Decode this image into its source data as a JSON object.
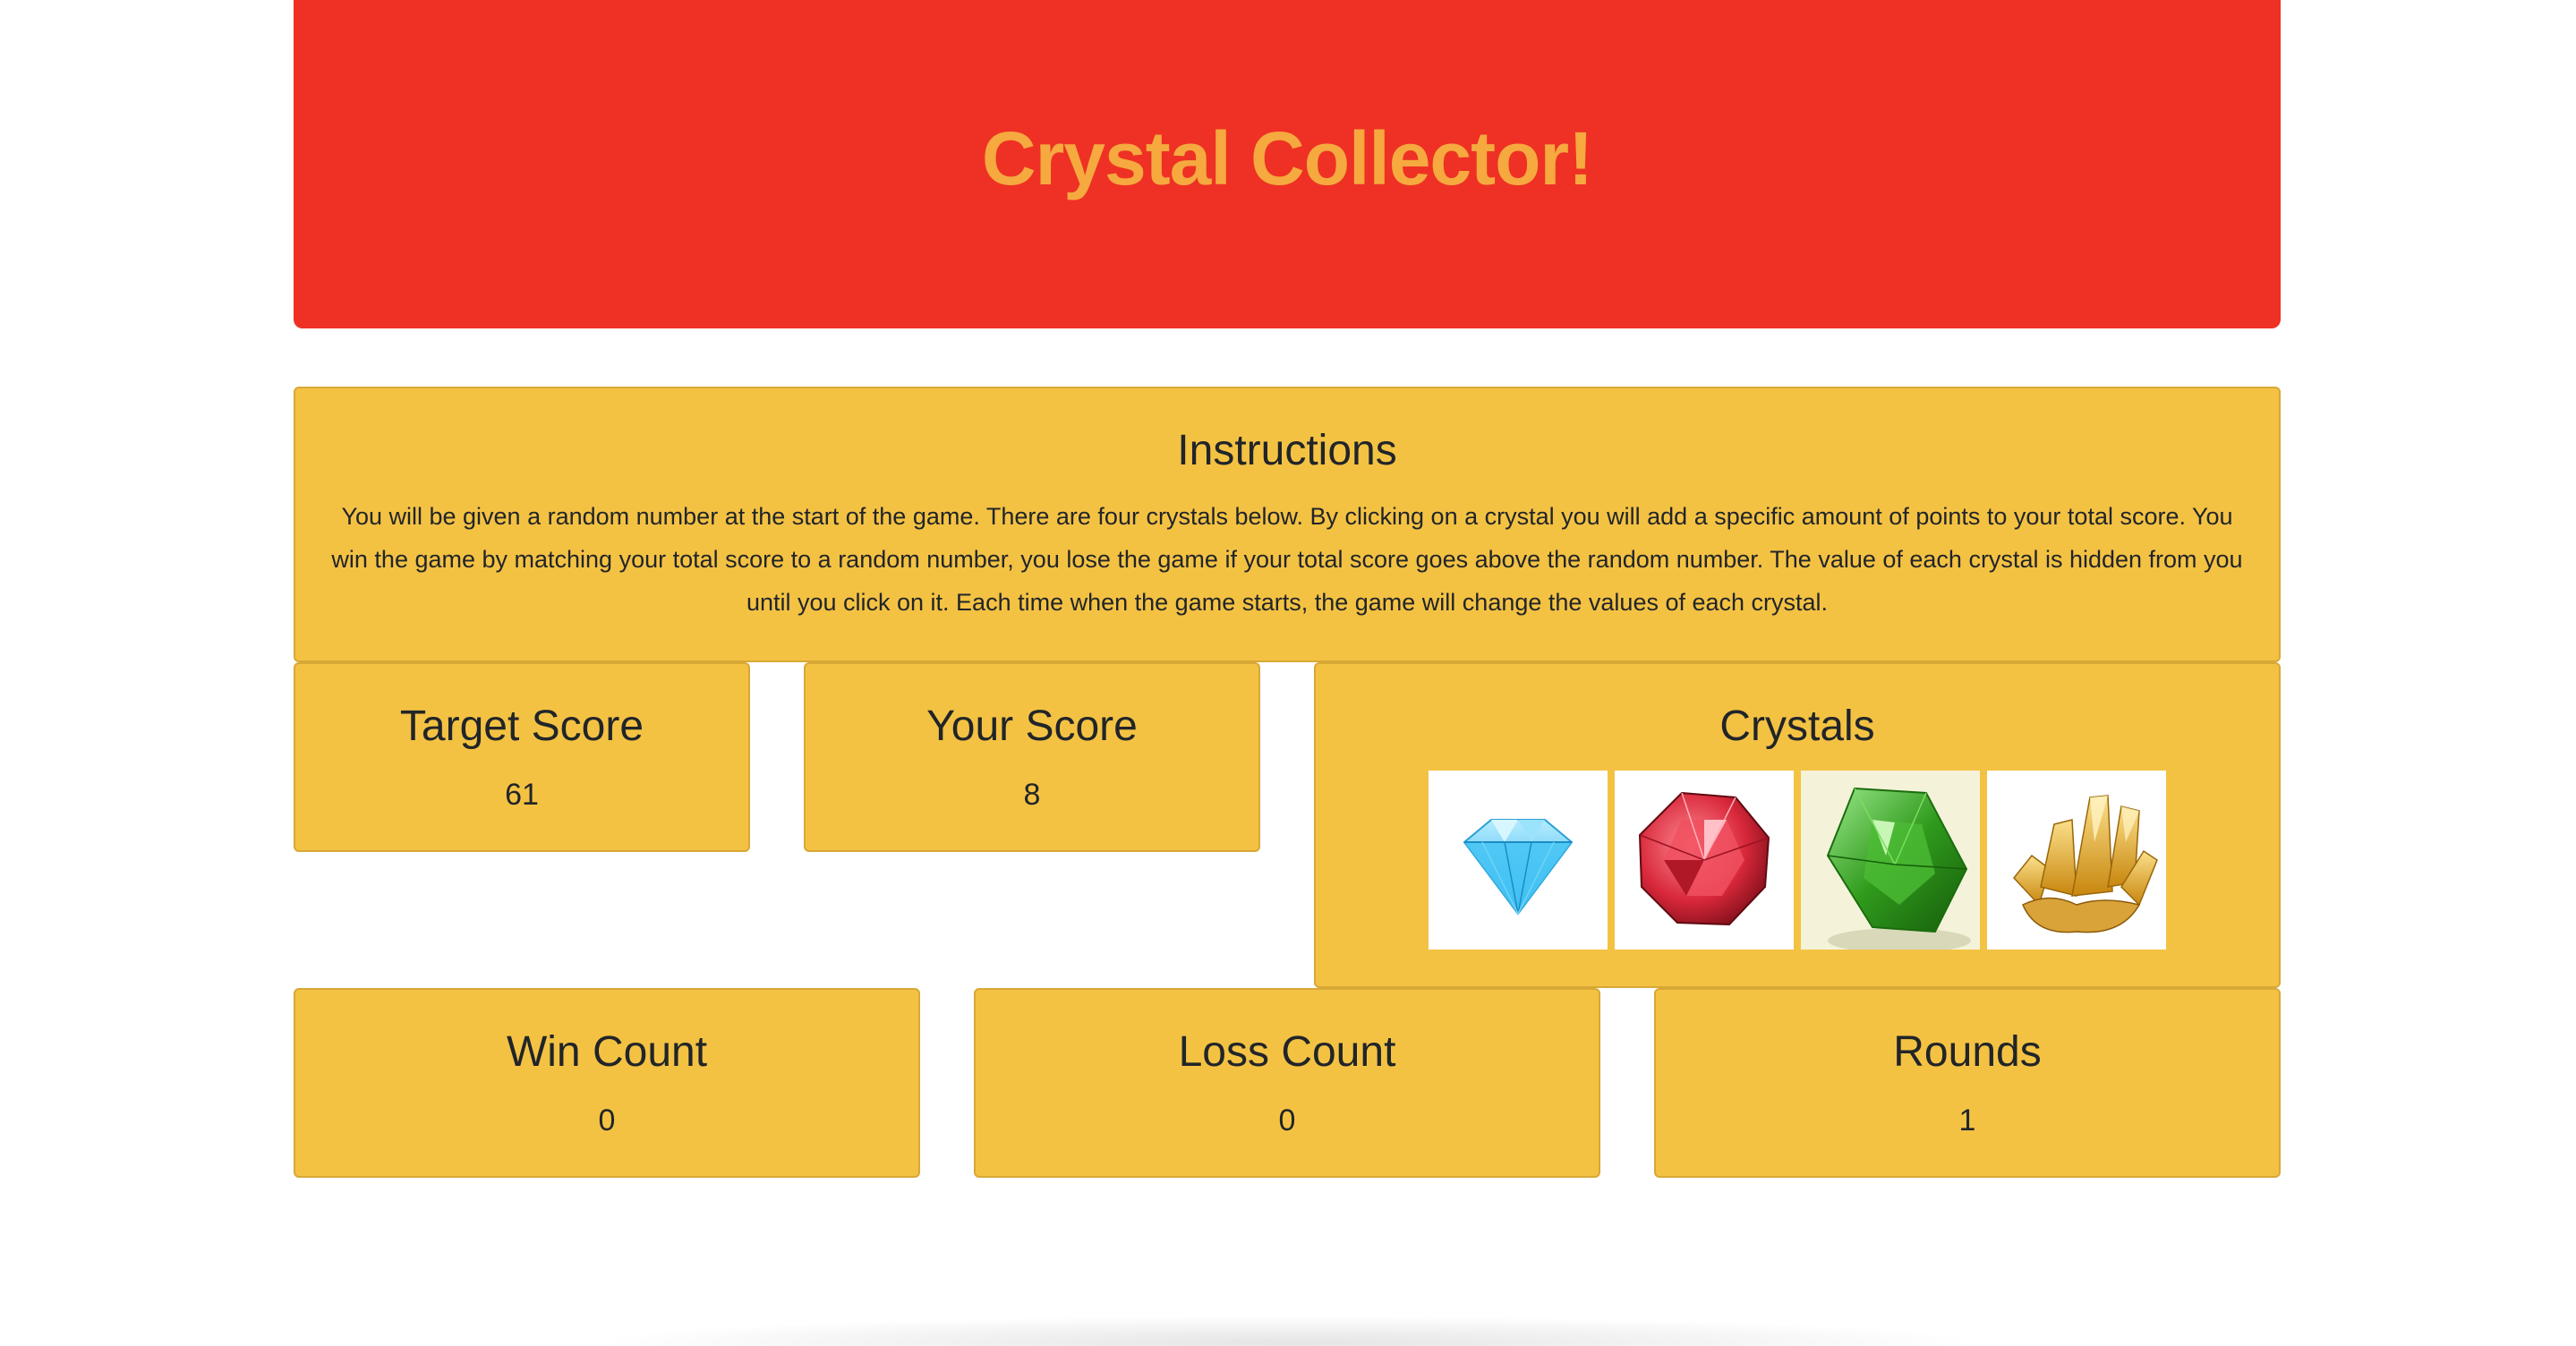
{
  "header": {
    "title": "Crystal Collector!"
  },
  "instructions": {
    "title": "Instructions",
    "text": "You will be given a random number at the start of the game. There are four crystals below. By clicking on a crystal you will add a specific amount of points to your total score. You win the game by matching your total score to a random number, you lose the game if your total score goes above the random number. The value of each crystal is hidden from you until you click on it. Each time when the game starts, the game will change the values of each crystal."
  },
  "target_score": {
    "label": "Target Score",
    "value": "61"
  },
  "your_score": {
    "label": "Your Score",
    "value": "8"
  },
  "crystals": {
    "label": "Crystals",
    "items": [
      {
        "icon": "blue-diamond-icon",
        "color": "#3fb8ee"
      },
      {
        "icon": "red-ruby-icon",
        "color": "#d8283a"
      },
      {
        "icon": "green-emerald-icon",
        "color": "#2f9a1c"
      },
      {
        "icon": "yellow-crystal-cluster-icon",
        "color": "#e8a81c"
      }
    ]
  },
  "win_count": {
    "label": "Win Count",
    "value": "0"
  },
  "loss_count": {
    "label": "Loss Count",
    "value": "0"
  },
  "rounds": {
    "label": "Rounds",
    "value": "1"
  },
  "colors": {
    "header_bg": "#ee3124",
    "header_text": "#f5a93f",
    "card_bg": "#f4c243"
  }
}
